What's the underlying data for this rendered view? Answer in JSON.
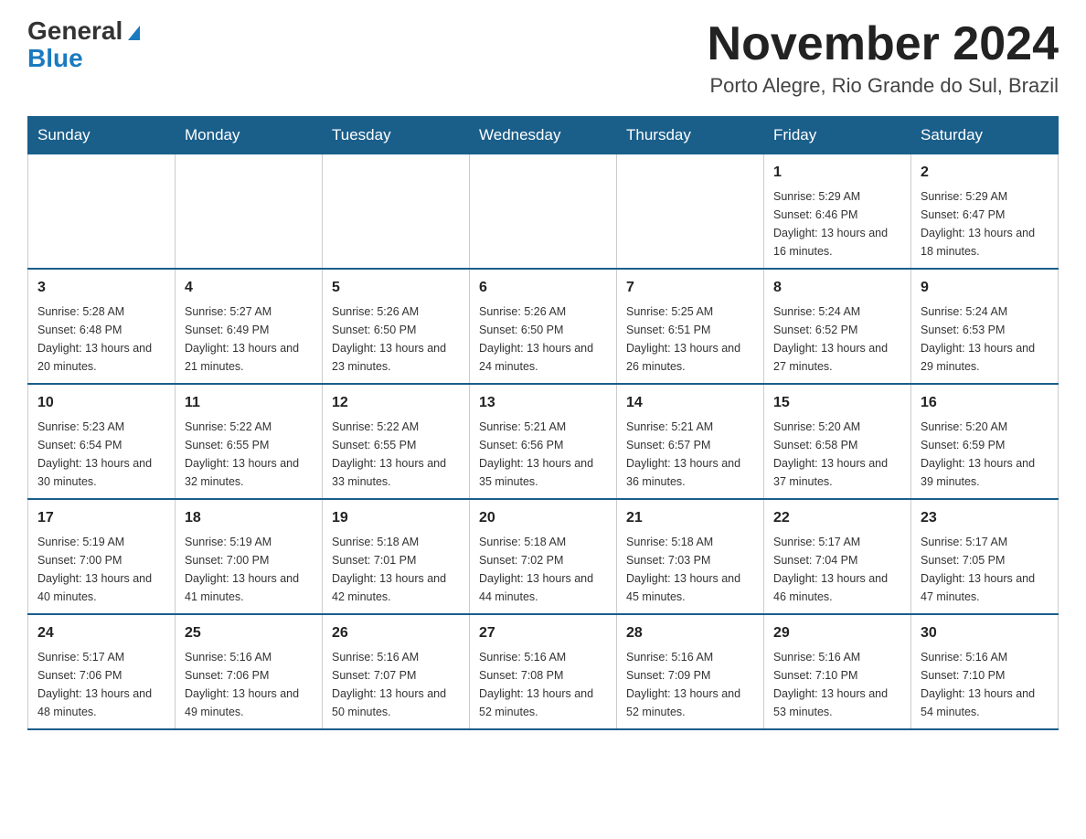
{
  "header": {
    "logo": {
      "general": "General",
      "blue": "Blue"
    },
    "title": "November 2024",
    "location": "Porto Alegre, Rio Grande do Sul, Brazil"
  },
  "weekdays": [
    "Sunday",
    "Monday",
    "Tuesday",
    "Wednesday",
    "Thursday",
    "Friday",
    "Saturday"
  ],
  "weeks": [
    [
      {
        "day": "",
        "sunrise": "",
        "sunset": "",
        "daylight": ""
      },
      {
        "day": "",
        "sunrise": "",
        "sunset": "",
        "daylight": ""
      },
      {
        "day": "",
        "sunrise": "",
        "sunset": "",
        "daylight": ""
      },
      {
        "day": "",
        "sunrise": "",
        "sunset": "",
        "daylight": ""
      },
      {
        "day": "",
        "sunrise": "",
        "sunset": "",
        "daylight": ""
      },
      {
        "day": "1",
        "sunrise": "Sunrise: 5:29 AM",
        "sunset": "Sunset: 6:46 PM",
        "daylight": "Daylight: 13 hours and 16 minutes."
      },
      {
        "day": "2",
        "sunrise": "Sunrise: 5:29 AM",
        "sunset": "Sunset: 6:47 PM",
        "daylight": "Daylight: 13 hours and 18 minutes."
      }
    ],
    [
      {
        "day": "3",
        "sunrise": "Sunrise: 5:28 AM",
        "sunset": "Sunset: 6:48 PM",
        "daylight": "Daylight: 13 hours and 20 minutes."
      },
      {
        "day": "4",
        "sunrise": "Sunrise: 5:27 AM",
        "sunset": "Sunset: 6:49 PM",
        "daylight": "Daylight: 13 hours and 21 minutes."
      },
      {
        "day": "5",
        "sunrise": "Sunrise: 5:26 AM",
        "sunset": "Sunset: 6:50 PM",
        "daylight": "Daylight: 13 hours and 23 minutes."
      },
      {
        "day": "6",
        "sunrise": "Sunrise: 5:26 AM",
        "sunset": "Sunset: 6:50 PM",
        "daylight": "Daylight: 13 hours and 24 minutes."
      },
      {
        "day": "7",
        "sunrise": "Sunrise: 5:25 AM",
        "sunset": "Sunset: 6:51 PM",
        "daylight": "Daylight: 13 hours and 26 minutes."
      },
      {
        "day": "8",
        "sunrise": "Sunrise: 5:24 AM",
        "sunset": "Sunset: 6:52 PM",
        "daylight": "Daylight: 13 hours and 27 minutes."
      },
      {
        "day": "9",
        "sunrise": "Sunrise: 5:24 AM",
        "sunset": "Sunset: 6:53 PM",
        "daylight": "Daylight: 13 hours and 29 minutes."
      }
    ],
    [
      {
        "day": "10",
        "sunrise": "Sunrise: 5:23 AM",
        "sunset": "Sunset: 6:54 PM",
        "daylight": "Daylight: 13 hours and 30 minutes."
      },
      {
        "day": "11",
        "sunrise": "Sunrise: 5:22 AM",
        "sunset": "Sunset: 6:55 PM",
        "daylight": "Daylight: 13 hours and 32 minutes."
      },
      {
        "day": "12",
        "sunrise": "Sunrise: 5:22 AM",
        "sunset": "Sunset: 6:55 PM",
        "daylight": "Daylight: 13 hours and 33 minutes."
      },
      {
        "day": "13",
        "sunrise": "Sunrise: 5:21 AM",
        "sunset": "Sunset: 6:56 PM",
        "daylight": "Daylight: 13 hours and 35 minutes."
      },
      {
        "day": "14",
        "sunrise": "Sunrise: 5:21 AM",
        "sunset": "Sunset: 6:57 PM",
        "daylight": "Daylight: 13 hours and 36 minutes."
      },
      {
        "day": "15",
        "sunrise": "Sunrise: 5:20 AM",
        "sunset": "Sunset: 6:58 PM",
        "daylight": "Daylight: 13 hours and 37 minutes."
      },
      {
        "day": "16",
        "sunrise": "Sunrise: 5:20 AM",
        "sunset": "Sunset: 6:59 PM",
        "daylight": "Daylight: 13 hours and 39 minutes."
      }
    ],
    [
      {
        "day": "17",
        "sunrise": "Sunrise: 5:19 AM",
        "sunset": "Sunset: 7:00 PM",
        "daylight": "Daylight: 13 hours and 40 minutes."
      },
      {
        "day": "18",
        "sunrise": "Sunrise: 5:19 AM",
        "sunset": "Sunset: 7:00 PM",
        "daylight": "Daylight: 13 hours and 41 minutes."
      },
      {
        "day": "19",
        "sunrise": "Sunrise: 5:18 AM",
        "sunset": "Sunset: 7:01 PM",
        "daylight": "Daylight: 13 hours and 42 minutes."
      },
      {
        "day": "20",
        "sunrise": "Sunrise: 5:18 AM",
        "sunset": "Sunset: 7:02 PM",
        "daylight": "Daylight: 13 hours and 44 minutes."
      },
      {
        "day": "21",
        "sunrise": "Sunrise: 5:18 AM",
        "sunset": "Sunset: 7:03 PM",
        "daylight": "Daylight: 13 hours and 45 minutes."
      },
      {
        "day": "22",
        "sunrise": "Sunrise: 5:17 AM",
        "sunset": "Sunset: 7:04 PM",
        "daylight": "Daylight: 13 hours and 46 minutes."
      },
      {
        "day": "23",
        "sunrise": "Sunrise: 5:17 AM",
        "sunset": "Sunset: 7:05 PM",
        "daylight": "Daylight: 13 hours and 47 minutes."
      }
    ],
    [
      {
        "day": "24",
        "sunrise": "Sunrise: 5:17 AM",
        "sunset": "Sunset: 7:06 PM",
        "daylight": "Daylight: 13 hours and 48 minutes."
      },
      {
        "day": "25",
        "sunrise": "Sunrise: 5:16 AM",
        "sunset": "Sunset: 7:06 PM",
        "daylight": "Daylight: 13 hours and 49 minutes."
      },
      {
        "day": "26",
        "sunrise": "Sunrise: 5:16 AM",
        "sunset": "Sunset: 7:07 PM",
        "daylight": "Daylight: 13 hours and 50 minutes."
      },
      {
        "day": "27",
        "sunrise": "Sunrise: 5:16 AM",
        "sunset": "Sunset: 7:08 PM",
        "daylight": "Daylight: 13 hours and 52 minutes."
      },
      {
        "day": "28",
        "sunrise": "Sunrise: 5:16 AM",
        "sunset": "Sunset: 7:09 PM",
        "daylight": "Daylight: 13 hours and 52 minutes."
      },
      {
        "day": "29",
        "sunrise": "Sunrise: 5:16 AM",
        "sunset": "Sunset: 7:10 PM",
        "daylight": "Daylight: 13 hours and 53 minutes."
      },
      {
        "day": "30",
        "sunrise": "Sunrise: 5:16 AM",
        "sunset": "Sunset: 7:10 PM",
        "daylight": "Daylight: 13 hours and 54 minutes."
      }
    ]
  ]
}
